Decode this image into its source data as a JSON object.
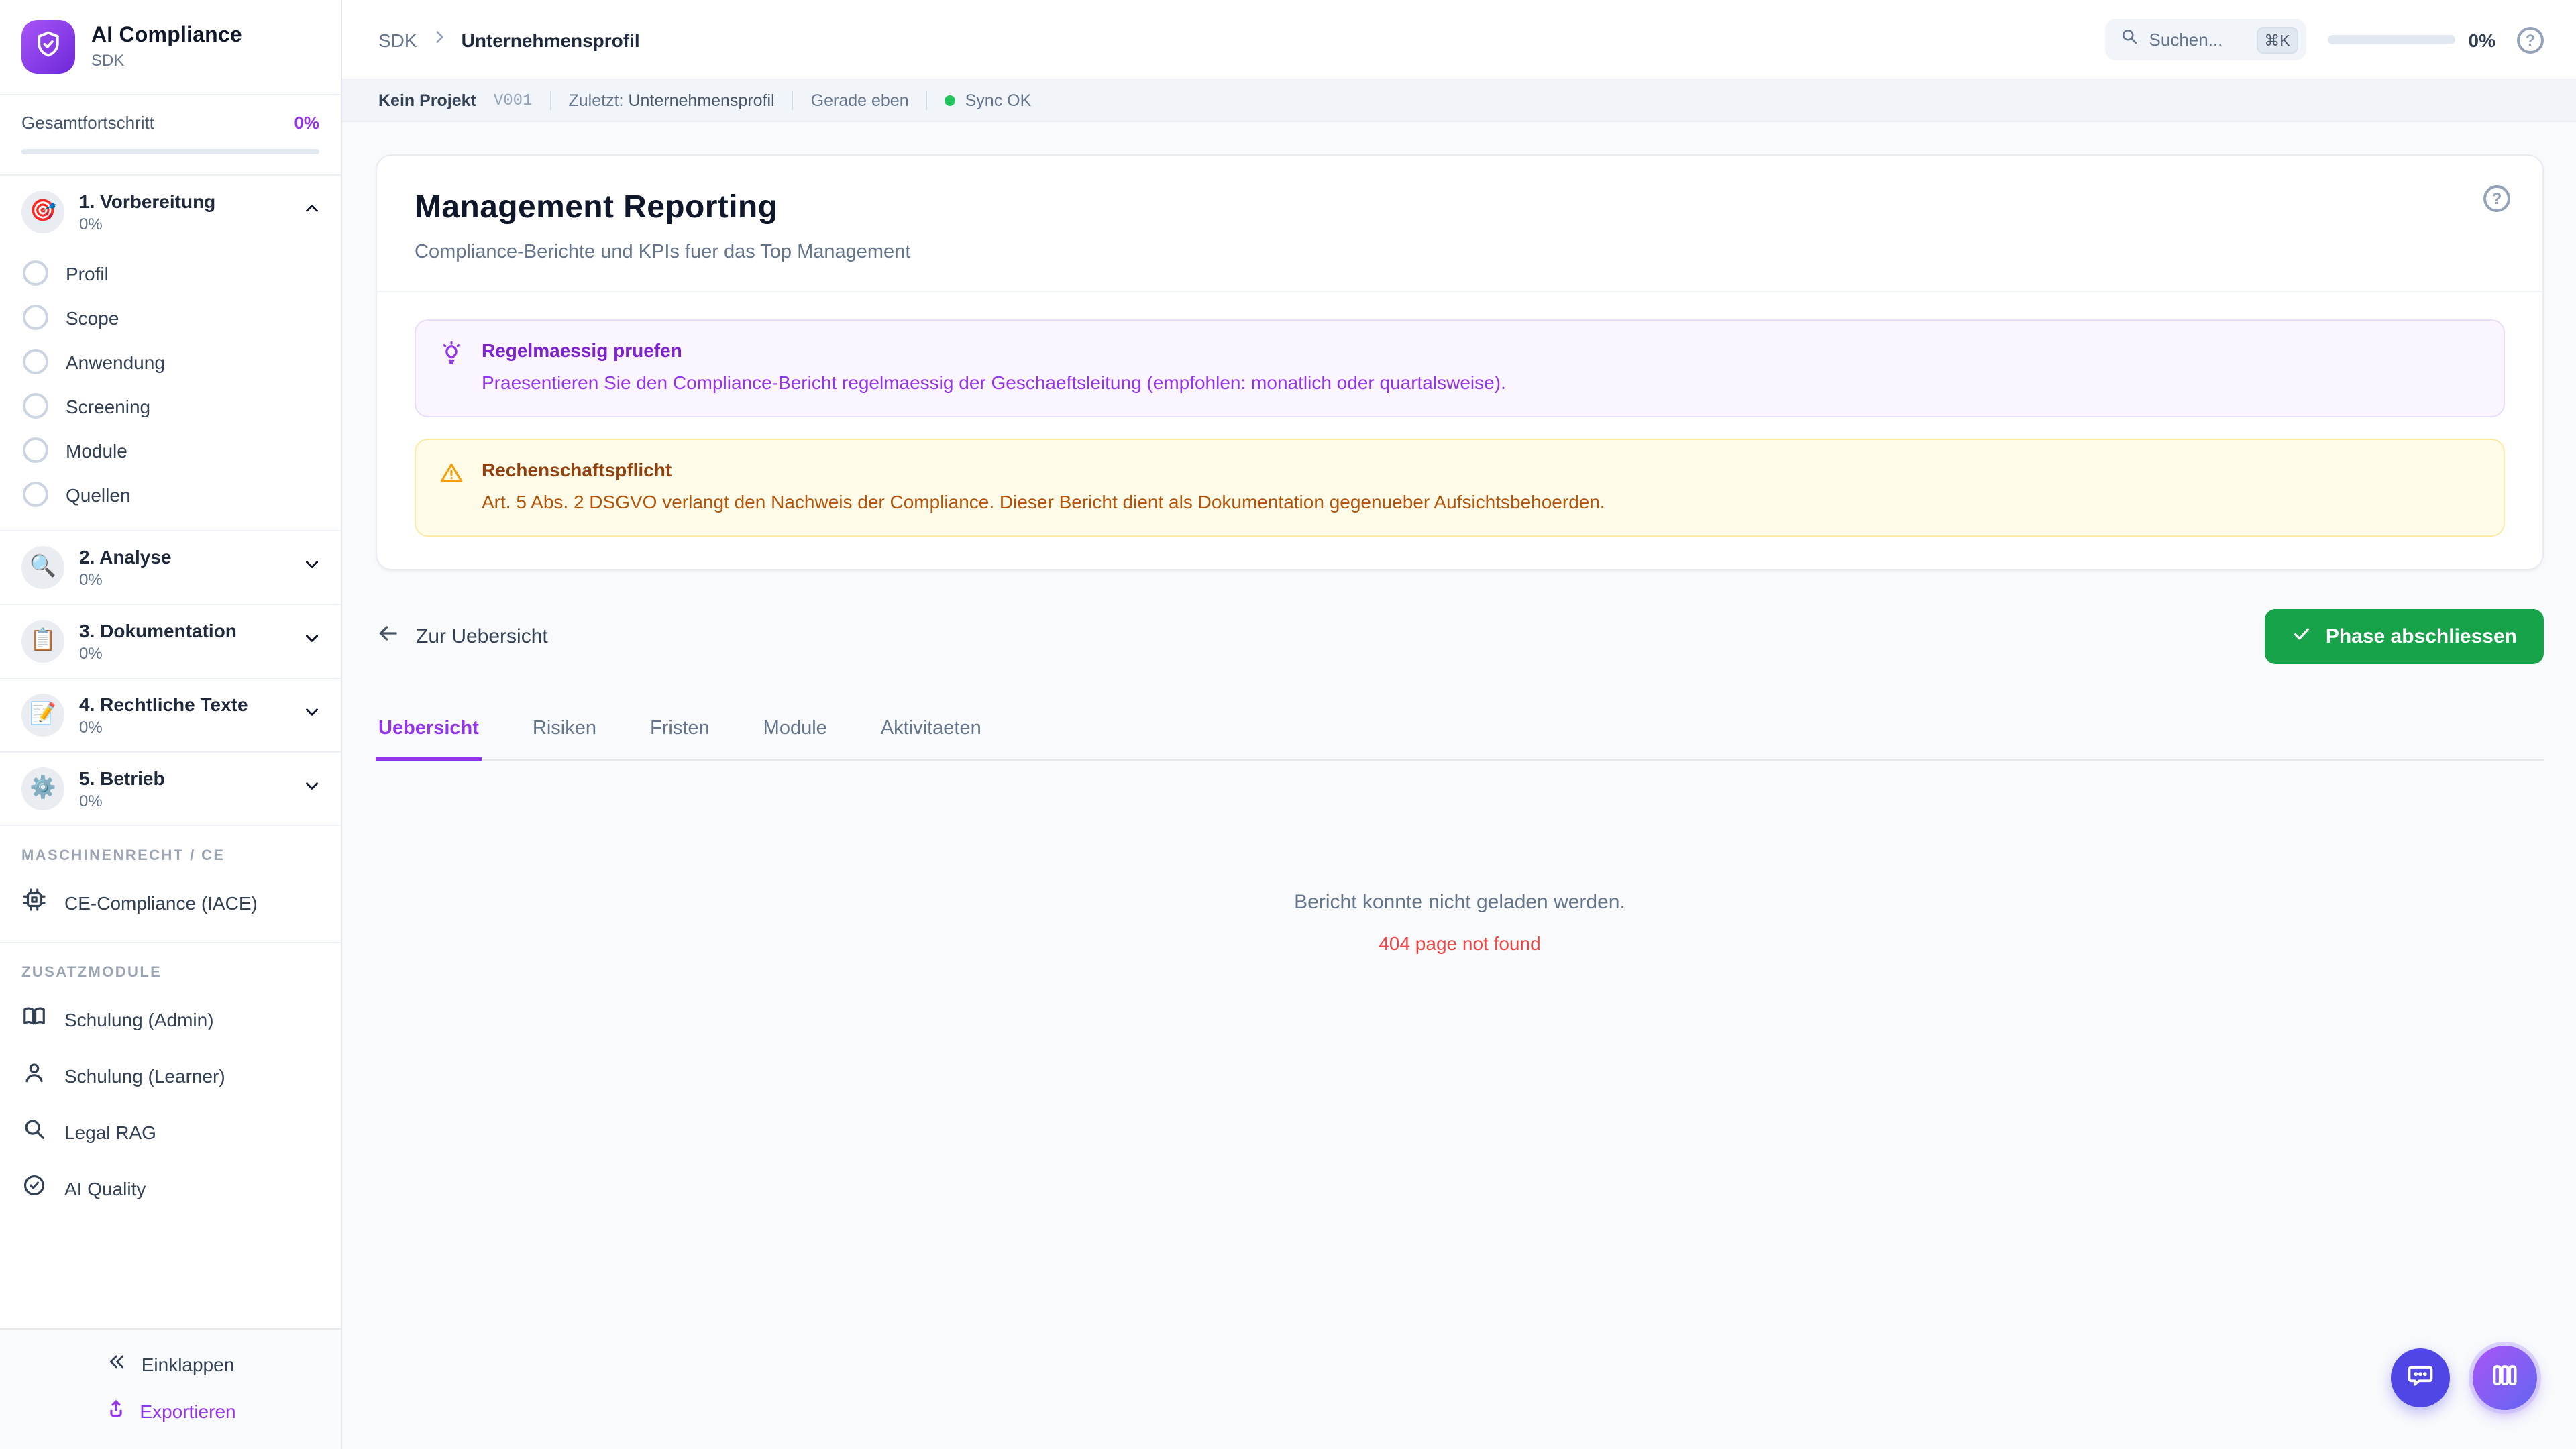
{
  "app": {
    "name": "AI Compliance",
    "subtitle": "SDK"
  },
  "sidebar": {
    "overall_label": "Gesamtfortschritt",
    "overall_value": "0%",
    "phases": [
      {
        "icon": "🎯",
        "label": "1. Vorbereitung",
        "progress": "0%",
        "expanded": true,
        "items": [
          "Profil",
          "Scope",
          "Anwendung",
          "Screening",
          "Module",
          "Quellen"
        ]
      },
      {
        "icon": "🔍",
        "label": "2. Analyse",
        "progress": "0%"
      },
      {
        "icon": "📋",
        "label": "3. Dokumentation",
        "progress": "0%"
      },
      {
        "icon": "📝",
        "label": "4. Rechtliche Texte",
        "progress": "0%"
      },
      {
        "icon": "⚙️",
        "label": "5. Betrieb",
        "progress": "0%"
      }
    ],
    "groups": [
      {
        "header": "MASCHINENRECHT / CE",
        "items": [
          {
            "icon": "cpu-icon",
            "label": "CE-Compliance (IACE)"
          }
        ]
      },
      {
        "header": "ZUSATZMODULE",
        "items": [
          {
            "icon": "book-icon",
            "label": "Schulung (Admin)"
          },
          {
            "icon": "user-icon",
            "label": "Schulung (Learner)"
          },
          {
            "icon": "search-icon",
            "label": "Legal RAG"
          },
          {
            "icon": "check-circle-icon",
            "label": "AI Quality"
          }
        ]
      }
    ],
    "collapse_label": "Einklappen",
    "export_label": "Exportieren"
  },
  "header": {
    "breadcrumb_root": "SDK",
    "breadcrumb_current": "Unternehmensprofil",
    "search_placeholder": "Suchen...",
    "search_shortcut": "⌘K",
    "progress_value": "0%"
  },
  "statusbar": {
    "project": "Kein Projekt",
    "version": "V001",
    "last_label": "Zuletzt:",
    "last_value": "Unternehmensprofil",
    "time": "Gerade eben",
    "sync": "Sync OK"
  },
  "card": {
    "title": "Management Reporting",
    "subtitle": "Compliance-Berichte und KPIs fuer das Top Management",
    "tip": {
      "title": "Regelmaessig pruefen",
      "body": "Praesentieren Sie den Compliance-Bericht regelmaessig der Geschaeftsleitung (empfohlen: monatlich oder quartalsweise)."
    },
    "warning": {
      "title": "Rechenschaftspflicht",
      "body": "Art. 5 Abs. 2 DSGVO verlangt den Nachweis der Compliance. Dieser Bericht dient als Dokumentation gegenueber Aufsichtsbehoerden."
    }
  },
  "actions": {
    "back_label": "Zur Uebersicht",
    "complete_label": "Phase abschliessen"
  },
  "tabs": [
    "Uebersicht",
    "Risiken",
    "Fristen",
    "Module",
    "Aktivitaeten"
  ],
  "empty": {
    "message": "Bericht konnte nicht geladen werden.",
    "error": "404 page not found"
  },
  "colors": {
    "accent": "#9333ea",
    "success": "#16a34a",
    "error": "#ef4444",
    "warning": "#f59e0b",
    "chat_fab": "#4f46e5",
    "sync_ok": "#22c55e"
  }
}
